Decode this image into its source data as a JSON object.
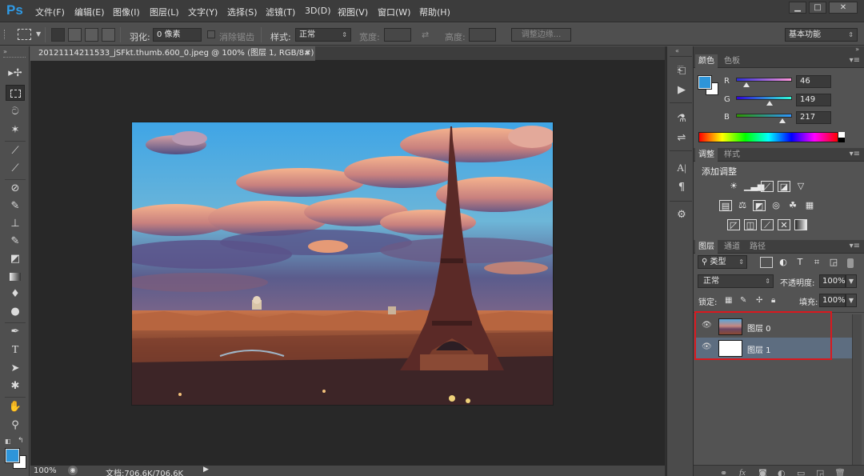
{
  "app": {
    "logo": "Ps"
  },
  "menu": [
    "文件(F)",
    "编辑(E)",
    "图像(I)",
    "图层(L)",
    "文字(Y)",
    "选择(S)",
    "滤镜(T)",
    "3D(D)",
    "视图(V)",
    "窗口(W)",
    "帮助(H)"
  ],
  "window_controls": {
    "minimize": "▁",
    "maximize": "□",
    "close": "✕"
  },
  "options": {
    "feather_label": "羽化:",
    "feather_value": "0 像素",
    "antialias_label": "消除锯齿",
    "style_label": "样式:",
    "style_value": "正常",
    "width_label": "宽度:",
    "height_label": "高度:",
    "refine_edge": "调整边缘...",
    "workspace": "基本功能"
  },
  "document": {
    "tab_title": "20121114211533_jSFkt.thumb.600_0.jpeg @ 100% (图层 1, RGB/8#) *",
    "tab_close": "×",
    "zoom": "100%",
    "doc_size": "文档:706.6K/706.6K"
  },
  "color_panel": {
    "tabs": [
      "颜色",
      "色板"
    ],
    "r_label": "R",
    "g_label": "G",
    "b_label": "B",
    "r": "46",
    "g": "149",
    "b": "217",
    "foreground": "#2e95d9",
    "background": "#ffffff"
  },
  "adjustments_panel": {
    "tabs": [
      "调整",
      "样式"
    ],
    "title": "添加调整"
  },
  "layers_panel": {
    "tabs": [
      "图层",
      "通道",
      "路径"
    ],
    "filter_kind": "类型",
    "blend_mode": "正常",
    "opacity_label": "不透明度:",
    "opacity_value": "100%",
    "lock_label": "锁定:",
    "fill_label": "填充:",
    "fill_value": "100%",
    "layers": [
      {
        "name": "图层 0",
        "selected": false
      },
      {
        "name": "图层 1",
        "selected": true
      }
    ]
  }
}
